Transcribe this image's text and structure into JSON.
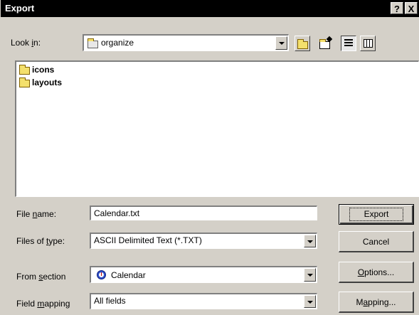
{
  "window": {
    "title": "Export",
    "help": "?",
    "close": "X"
  },
  "lookin": {
    "label_pre": "Look ",
    "label_u": "i",
    "label_post": "n:",
    "value": "organize"
  },
  "files": [
    {
      "name": "icons"
    },
    {
      "name": "layouts"
    }
  ],
  "filename": {
    "label_pre": "File ",
    "label_u": "n",
    "label_post": "ame:",
    "value": "Calendar.txt"
  },
  "filetype": {
    "label_pre": "Files of ",
    "label_u": "t",
    "label_post": "ype:",
    "value": "ASCII Delimited Text (*.TXT)"
  },
  "section": {
    "label_pre": "From ",
    "label_u": "s",
    "label_post": "ection",
    "value": "Calendar"
  },
  "mapping": {
    "label_pre": "Field ",
    "label_u": "m",
    "label_post": "apping",
    "value": "All fields"
  },
  "buttons": {
    "export": "Export",
    "cancel": "Cancel",
    "options_u": "O",
    "options_rest": "ptions...",
    "mapping_pre": "M",
    "mapping_u": "a",
    "mapping_rest": "pping..."
  },
  "colors": {
    "titlebar": "#000000",
    "face": "#d4d0c8",
    "folder": "#f4e06c"
  }
}
